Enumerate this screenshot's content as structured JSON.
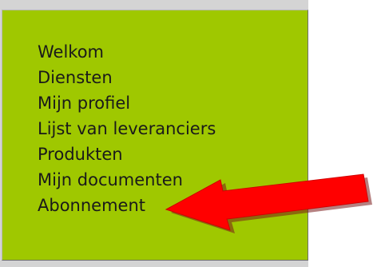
{
  "menu": {
    "items": [
      {
        "label": "Welkom"
      },
      {
        "label": "Diensten"
      },
      {
        "label": "Mijn profiel"
      },
      {
        "label": "Lijst van leveranciers"
      },
      {
        "label": "Produkten"
      },
      {
        "label": "Mijn documenten"
      },
      {
        "label": "Abonnement"
      }
    ]
  },
  "colors": {
    "panel_background": "#9fc800",
    "arrow": "#ff0000",
    "frame": "#d4d4d4"
  },
  "icons": {
    "annotation": "red-arrow-icon"
  }
}
